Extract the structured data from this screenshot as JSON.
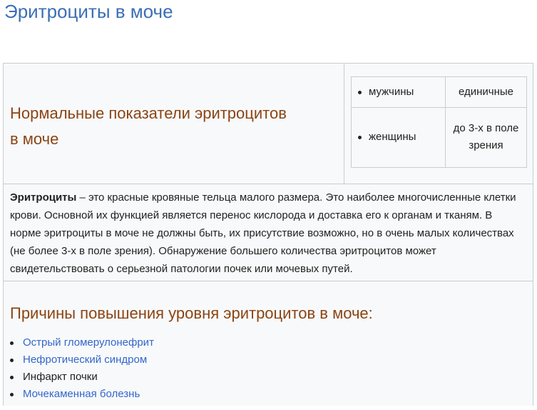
{
  "page": {
    "title": "Эритроциты в моче"
  },
  "norms": {
    "heading_line1": "Нормальные показатели эритроцитов",
    "heading_line2": "в моче",
    "rows": [
      {
        "sex": "мужчины",
        "value": "единичные"
      },
      {
        "sex": "женщины",
        "value": "до 3-х в поле зрения"
      }
    ]
  },
  "description": {
    "term": "Эритроциты",
    "text": " – это красные кровяные тельца малого размера.  Это наиболее многочисленные клетки крови. Основной их функцией является перенос кислорода и доставка его к органам и тканям. В норме эритроциты в моче не должны быть, их присутствие возможно, но в очень малых количествах (не более 3-х в поле зрения). Обнаружение большего количества эритроцитов может свидетельствовать о серьезной патологии почек или мочевых путей."
  },
  "causes": {
    "heading": "Причины повышения уровня эритроцитов в моче:",
    "items": [
      {
        "label": "Острый гломерулонефрит",
        "is_link": true
      },
      {
        "label": "Нефротический синдром",
        "is_link": true
      },
      {
        "label": "Инфаркт почки",
        "is_link": false
      },
      {
        "label": "Мочекаменная болезнь",
        "is_link": true
      }
    ]
  },
  "colors": {
    "title": "#3b6fb6",
    "heading": "#8a4514",
    "link": "#3366cc",
    "table_bg": "#f8f9fa",
    "border": "#c8ccd1"
  }
}
